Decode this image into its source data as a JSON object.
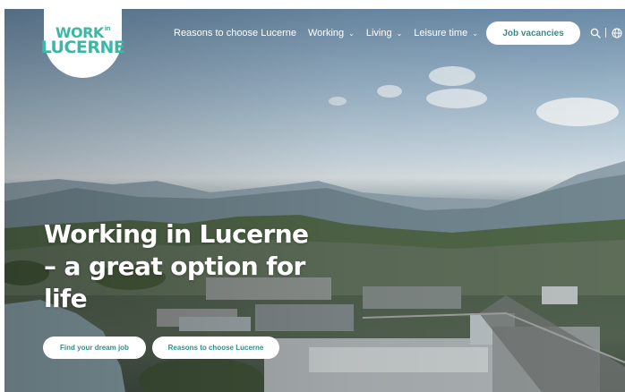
{
  "logo": {
    "line1": "WORK",
    "line2": "LUCERNE",
    "small": "in"
  },
  "nav": {
    "items": [
      {
        "label": "Reasons to choose Lucerne",
        "has_dropdown": false
      },
      {
        "label": "Working",
        "has_dropdown": true
      },
      {
        "label": "Living",
        "has_dropdown": true
      },
      {
        "label": "Leisure time",
        "has_dropdown": true
      }
    ],
    "chevron": "⌄",
    "job_button": "Job vacancies",
    "divider": "|"
  },
  "icons": {
    "search": "search-icon",
    "language": "globe-icon",
    "dropdown": "chevron-down-icon"
  },
  "hero": {
    "headline_lines": [
      "Working in Lucerne",
      "– a great option for",
      "life"
    ],
    "cta_primary": "Find your dream job",
    "cta_secondary": "Reasons to choose Lucerne"
  },
  "colors": {
    "brand": "#3ab8a6",
    "button_text": "#2f8f86",
    "text_light": "#ffffff"
  }
}
